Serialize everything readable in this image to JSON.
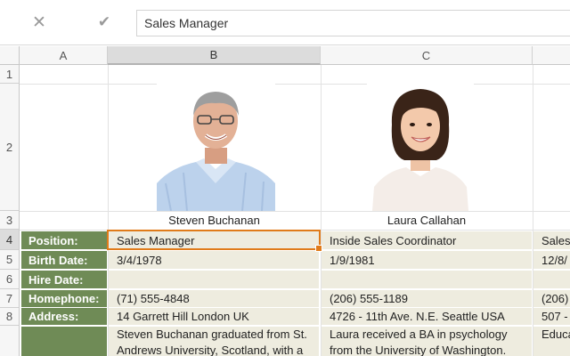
{
  "formula_bar": {
    "cancel_icon": "close-icon",
    "confirm_icon": "check-icon",
    "value": "Sales Manager"
  },
  "columns": [
    "A",
    "B",
    "C"
  ],
  "rows": [
    "1",
    "2",
    "3",
    "4",
    "5",
    "6",
    "7",
    "8"
  ],
  "employees": [
    {
      "name": "Steven Buchanan",
      "position": "Sales Manager",
      "birth_date": "3/4/1978",
      "hire_date": "",
      "homephone": "(71) 555-4848",
      "address": "14 Garrett Hill London  UK",
      "notes": "Steven Buchanan graduated from St. Andrews University, Scotland, with a"
    },
    {
      "name": "Laura Callahan",
      "position": "Inside Sales Coordinator",
      "birth_date": "1/9/1981",
      "hire_date": "",
      "homephone": "(206) 555-1189",
      "address": "4726 - 11th Ave. N.E. Seattle  USA",
      "notes": "Laura received a BA in psychology from the University of Washington."
    },
    {
      "position": "Sales",
      "birth_date": "12/8/",
      "hire_date": "",
      "homephone": "(206)",
      "address": "507 -",
      "notes": "Educa"
    }
  ],
  "labels": {
    "position": "Position:",
    "birth_date": "Birth Date:",
    "hire_date": "Hire Date:",
    "homephone": "Homephone:",
    "address": "Address:"
  },
  "colors": {
    "label_bg": "#6f8b56",
    "data_bg": "#eeecdf",
    "selection": "#e07b1a"
  }
}
